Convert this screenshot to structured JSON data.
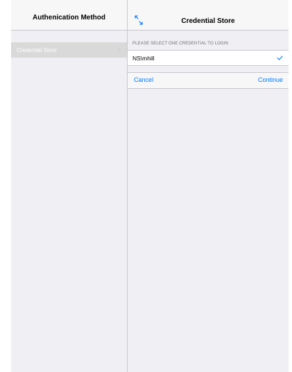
{
  "left_pane": {
    "title": "Authenication Method",
    "items": [
      {
        "label": "Credential Store",
        "selected": true
      }
    ]
  },
  "right_pane": {
    "title": "Credential Store",
    "section_header": "PLEASE SELECT ONE CREDENTIAL TO LOGIN",
    "credentials": [
      {
        "label": "NS\\mhill",
        "checked": true
      }
    ],
    "actions": {
      "cancel_label": "Cancel",
      "continue_label": "Continue"
    }
  },
  "icons": {
    "expand": "expand-arrows-icon",
    "checkmark": "checkmark-icon",
    "chevron": "chevron-right-icon"
  },
  "colors": {
    "accent": "#007aff",
    "background": "#efeff4",
    "header": "#f7f7f7",
    "selected_row": "#d9d9d9"
  }
}
